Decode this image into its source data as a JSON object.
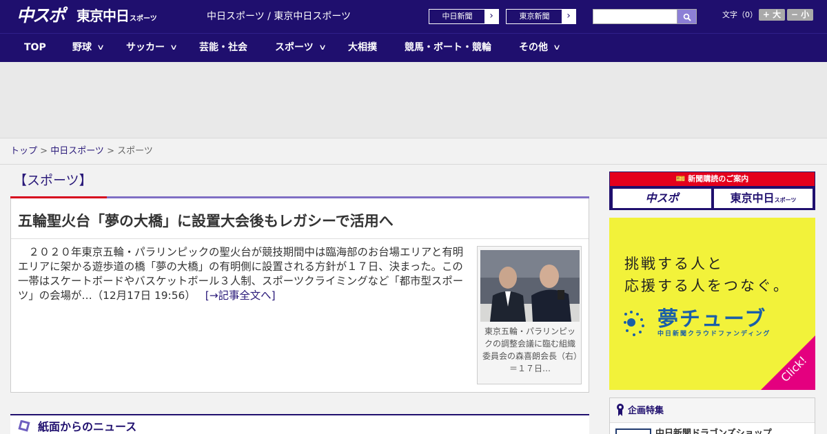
{
  "header": {
    "logo_chuspo": "中スポ",
    "logo_tokyo": "東京中日",
    "logo_tokyo_small": "スポーツ",
    "site_names": "中日スポーツ / 東京中日スポーツ",
    "links": [
      {
        "label": "中日新聞",
        "arrow": "›"
      },
      {
        "label": "東京新聞",
        "arrow": "›"
      }
    ],
    "search": {
      "placeholder": ""
    },
    "font_size": {
      "label": "文字（0）",
      "larger": "+ 大",
      "smaller": "− 小"
    }
  },
  "nav": {
    "items": [
      {
        "label": "TOP",
        "has_dropdown": false
      },
      {
        "label": "野球",
        "has_dropdown": true
      },
      {
        "label": "サッカー",
        "has_dropdown": true
      },
      {
        "label": "芸能・社会",
        "has_dropdown": false
      },
      {
        "label": "スポーツ",
        "has_dropdown": true
      },
      {
        "label": "大相撲",
        "has_dropdown": false
      },
      {
        "label": "競馬・ボート・競輪",
        "has_dropdown": false
      },
      {
        "label": "その他",
        "has_dropdown": true
      }
    ],
    "chevron": "∨"
  },
  "breadcrumb": {
    "items": [
      "トップ",
      "中日スポーツ",
      "スポーツ"
    ],
    "separator": " > "
  },
  "section": {
    "title": "【スポーツ】"
  },
  "article": {
    "title": "五輪聖火台「夢の大橋」に設置大会後もレガシーで活用へ",
    "body": "　２０２０年東京五輪・パラリンピックの聖火台が競技期間中は臨海部のお台場エリアと有明エリアに架かる遊歩道の橋「夢の大橋」の有明側に設置される方針が１７日、決まった。この一帯はスケートボードやバスケットボール３人制、スポーツクライミングなど「都市型スポーツ」の会場が…（12月17日 19:56）",
    "more_label": "[→記事全文へ]",
    "photo_caption": "東京五輪・パラリンピックの調整会議に臨む組織委員会の森喜朗会長（右）＝１７日…"
  },
  "paper_news": {
    "title": "紙面からのニュース"
  },
  "sidebar": {
    "subscribe": {
      "title": "新聞購読のご案内",
      "logos": [
        "中スポ",
        "東京中日"
      ],
      "logo_small": "スポーツ"
    },
    "banner": {
      "line1": "挑戦する人と",
      "line2": "応援する人をつなぐ。",
      "brand": "夢チューブ",
      "sub": "中日新聞クラウドファンディング",
      "click": "Click!"
    },
    "special": {
      "title": "企画特集",
      "item": "中日新聞ドラゴンズショップ"
    }
  },
  "colors": {
    "brand_navy": "#1f0f6e",
    "accent_red": "#d6001c",
    "banner_yellow": "#f2f23a",
    "banner_magenta": "#e4007f"
  }
}
